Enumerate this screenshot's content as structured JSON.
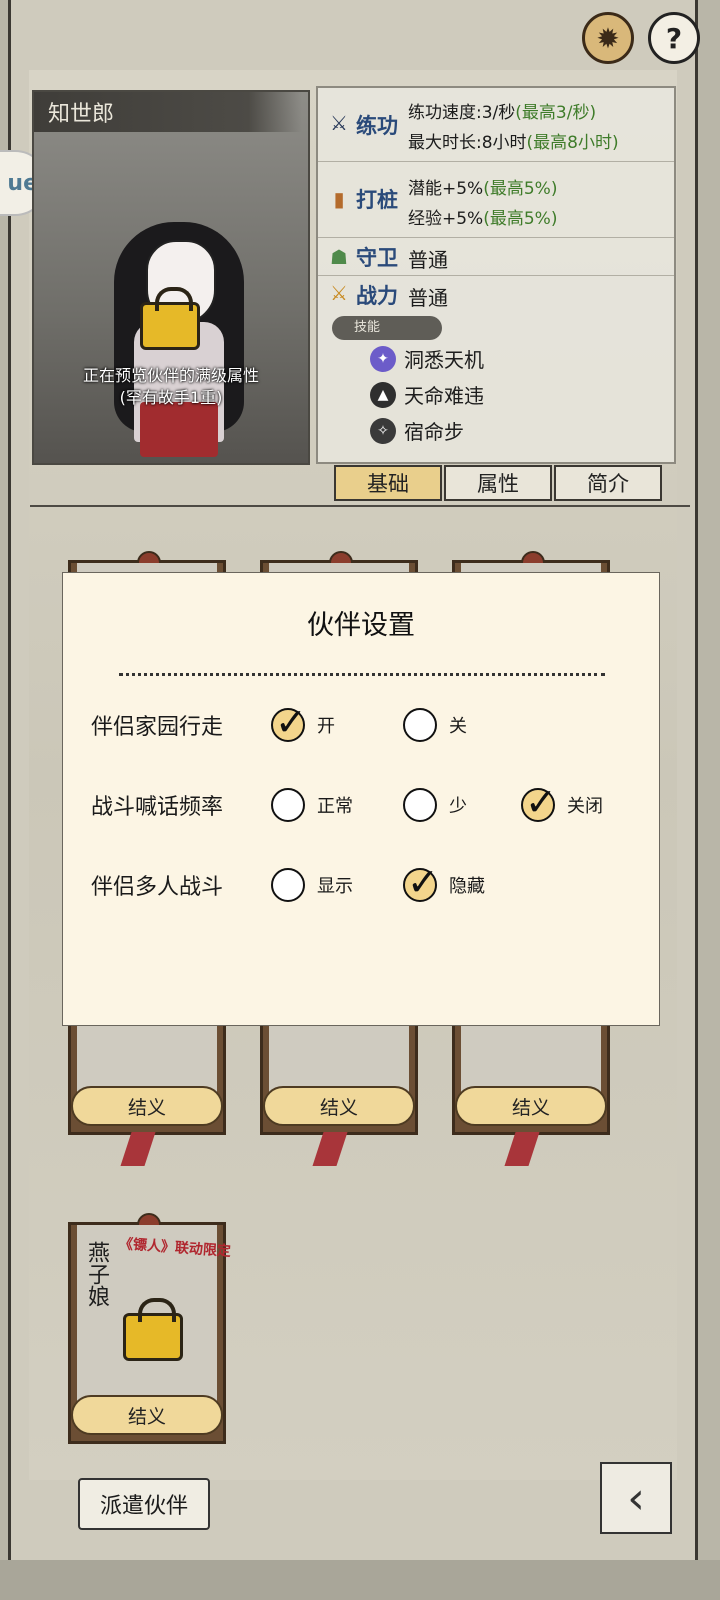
{
  "header": {
    "settings_icon": "gear-icon",
    "help_label": "?"
  },
  "side_badge": "ue",
  "portrait": {
    "name": "知世郎",
    "preview_line1": "正在预览伙伴的满级属性",
    "preview_line2": "(罕有故手1重)"
  },
  "stats": {
    "practice": {
      "label": "练功",
      "line1_prefix": "练功速度:3/秒",
      "line1_max": "(最高3/秒)",
      "line2_prefix": "最大时长:8小时",
      "line2_max": "(最高8小时)"
    },
    "stake": {
      "label": "打桩",
      "line1_prefix": "潜能+5%",
      "line1_max": "(最高5%)",
      "line2_prefix": "经验+5%",
      "line2_max": "(最高5%)"
    },
    "guard": {
      "label": "守卫",
      "value": "普通"
    },
    "power": {
      "label": "战力",
      "value": "普通"
    },
    "skills_header": "技能",
    "skills": [
      "洞悉天机",
      "天命难违",
      "宿命步"
    ]
  },
  "tabs": [
    "基础",
    "属性",
    "简介"
  ],
  "active_tab": "基础",
  "cards_row": {
    "button_label": "结义"
  },
  "card_bottom": {
    "name": "燕子娘",
    "collab_tag": "《镖人》联动限定",
    "button_label": "结义"
  },
  "modal": {
    "title": "伙伴设置",
    "rows": [
      {
        "label": "伴侣家园行走",
        "options": [
          {
            "text": "开",
            "checked": true
          },
          {
            "text": "关",
            "checked": false
          }
        ]
      },
      {
        "label": "战斗喊话频率",
        "options": [
          {
            "text": "正常",
            "checked": false
          },
          {
            "text": "少",
            "checked": false
          },
          {
            "text": "关闭",
            "checked": true
          }
        ]
      },
      {
        "label": "伴侣多人战斗",
        "options": [
          {
            "text": "显示",
            "checked": false
          },
          {
            "text": "隐藏",
            "checked": true
          }
        ]
      }
    ]
  },
  "footer": {
    "dispatch_label": "派遣伙伴",
    "back_icon": "back-arrow-icon"
  }
}
